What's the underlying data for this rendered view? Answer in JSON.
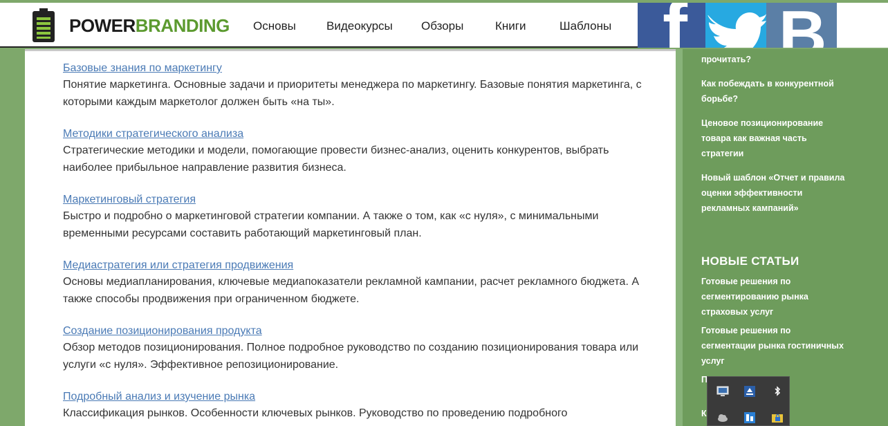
{
  "header": {
    "brand_part1": "POWER",
    "brand_part2": "BRANDING",
    "nav": [
      "Основы",
      "Видеокурсы",
      "Обзоры",
      "Книги",
      "Шаблоны"
    ]
  },
  "social": {
    "facebook_glyph": "f",
    "vk_glyph": "B"
  },
  "articles": [
    {
      "title": "Базовые знания по маркетингу",
      "description": "Понятие маркетинга. Основные задачи и приоритеты менеджера по маркетингу. Базовые понятия маркетинга, с которыми каждым маркетолог должен быть «на ты»."
    },
    {
      "title": "Методики стратегического анализа",
      "description": "Стратегические методики и модели, помогающие провести бизнес-анализ, оценить конкурентов, выбрать наиболее прибыльное направление развития бизнеса."
    },
    {
      "title": "Маркетинговый стратегия",
      "description": "Быстро и подробно о маркетинговой стратегии компании. А также о том, как «с нуля», с минимальными временными ресурсами составить работающий маркетинговый план."
    },
    {
      "title": "Медиастратегия или стратегия продвижения",
      "description": "Основы медиапланирования, ключевые медиапоказатели рекламной кампании, расчет рекламного бюджета. А также способы продвижения при ограниченном бюджете."
    },
    {
      "title": "Создание позиционирования продукта",
      "description": "Обзор методов позиционирования. Полное подробное руководство по созданию позиционирования товара или услуги «с нуля». Эффективное репозиционирование."
    },
    {
      "title": "Подробный анализ и изучение рынка",
      "description": "Классификация рынков. Особенности ключевых рынков. Руководство по проведению подробного"
    }
  ],
  "sidebar": {
    "popular": [
      "прочитать?",
      "Как побеждать в конкурентной борьбе?",
      "Ценовое позиционирование товара как важная часть стратегии",
      "Новый шаблон «Отчет и правила оценки эффективности рекламных кампаний»"
    ],
    "new_heading": "НОВЫЕ СТАТЬИ",
    "new_articles": [
      "Готовые решения по сегментированию рынка страховых услуг",
      "Готовые решения по сегментации рынка гостиничных услуг",
      "П                    о модели Б",
      "К                    ешный"
    ]
  },
  "tray_icons": [
    "monitor-icon",
    "update-icon",
    "bluetooth-icon",
    "cloud-icon",
    "network-icon",
    "lock-folder-icon"
  ]
}
